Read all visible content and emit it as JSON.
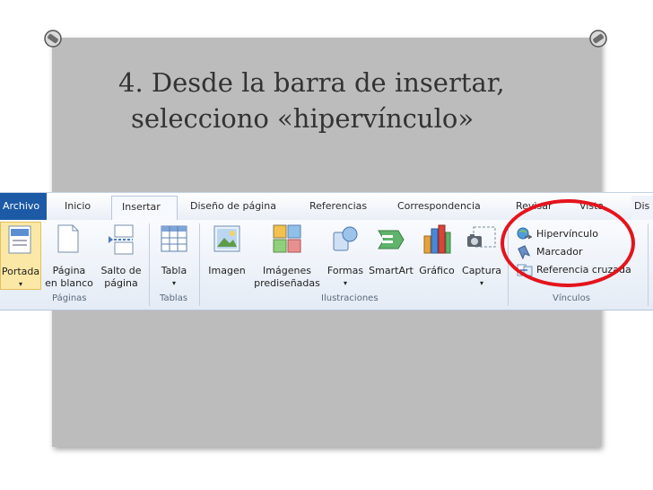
{
  "slide": {
    "title_line_1": "4. Desde la barra de insertar,",
    "title_line_2": "selecciono «hipervínculo»"
  },
  "ribbon": {
    "tabs": {
      "archivo": "Archivo",
      "inicio": "Inicio",
      "insertar": "Insertar",
      "diseno": "Diseño de página",
      "referencias": "Referencias",
      "correspondencia": "Correspondencia",
      "revisar": "Revisar",
      "vista": "Vista",
      "extra": "Dis"
    },
    "commands": {
      "portada": "Portada",
      "pagina_en_blanco_1": "Página",
      "pagina_en_blanco_2": "en blanco",
      "salto_1": "Salto de",
      "salto_2": "página",
      "tabla": "Tabla",
      "imagen": "Imagen",
      "imagenes_1": "Imágenes",
      "imagenes_2": "prediseñadas",
      "formas": "Formas",
      "smartart": "SmartArt",
      "grafico": "Gráfico",
      "captura": "Captura",
      "hipervinculo": "Hipervínculo",
      "marcador": "Marcador",
      "referencia_cruzada": "Referencia cruzada"
    },
    "groups": {
      "paginas": "Páginas",
      "tablas": "Tablas",
      "ilustraciones": "Ilustraciones",
      "vinculos": "Vínculos"
    }
  },
  "colors": {
    "slide_background": "#bcbcbc",
    "title_text": "#333333",
    "highlight_circle": "#e4141c",
    "file_tab": "#1c5aa6"
  }
}
